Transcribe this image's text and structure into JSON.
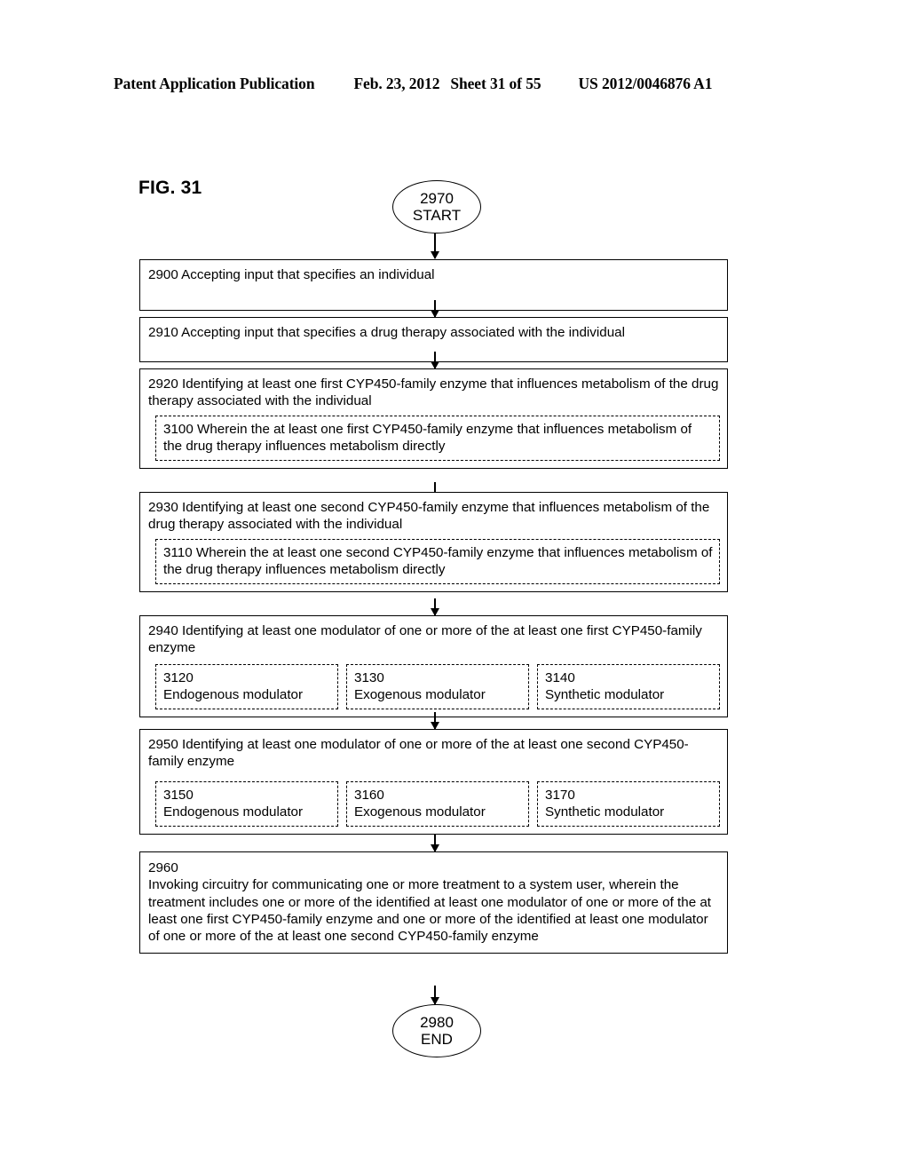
{
  "header": {
    "publication": "Patent Application Publication",
    "date": "Feb. 23, 2012",
    "sheet": "Sheet 31 of 55",
    "publication_number": "US 2012/0046876 A1"
  },
  "figure": {
    "label": "FIG. 31"
  },
  "flow": {
    "start": {
      "number": "2970",
      "label": "START"
    },
    "end": {
      "number": "2980",
      "label": "END"
    },
    "steps": [
      {
        "id": "2900",
        "text": "2900  Accepting input that specifies an individual"
      },
      {
        "id": "2910",
        "text": "2910  Accepting input that specifies a drug therapy associated with the individual"
      },
      {
        "id": "2920",
        "text": "2920  Identifying at least one first CYP450-family enzyme that influences metabolism of the drug therapy associated with the individual",
        "sub": {
          "id": "3100",
          "text": "3100  Wherein the at least one first CYP450-family enzyme that influences metabolism of the drug therapy influences metabolism directly"
        }
      },
      {
        "id": "2930",
        "text": "2930  Identifying at least one second CYP450-family enzyme that influences metabolism of the drug therapy associated with the individual",
        "sub": {
          "id": "3110",
          "text": "3110  Wherein the at least one second CYP450-family enzyme that influences metabolism of the drug therapy influences metabolism directly"
        }
      },
      {
        "id": "2940",
        "text": "2940  Identifying at least one modulator of one or more of the at least one first CYP450-family enzyme",
        "cells": [
          {
            "id": "3120",
            "label": "Endogenous modulator"
          },
          {
            "id": "3130",
            "label": "Exogenous modulator"
          },
          {
            "id": "3140",
            "label": "Synthetic modulator"
          }
        ]
      },
      {
        "id": "2950",
        "text": "2950  Identifying at least one modulator of one or more of the at least one second CYP450-family enzyme",
        "cells": [
          {
            "id": "3150",
            "label": "Endogenous modulator"
          },
          {
            "id": "3160",
            "label": "Exogenous modulator"
          },
          {
            "id": "3170",
            "label": "Synthetic modulator"
          }
        ]
      },
      {
        "id": "2960",
        "text": "2960\nInvoking circuitry for communicating one or more treatment to a system user, wherein the treatment includes one or more of the identified at least one modulator of one or more of the at least one first CYP450-family enzyme and one or more of the identified at least one modulator of one or more of the at least one second CYP450-family enzyme"
      }
    ]
  }
}
